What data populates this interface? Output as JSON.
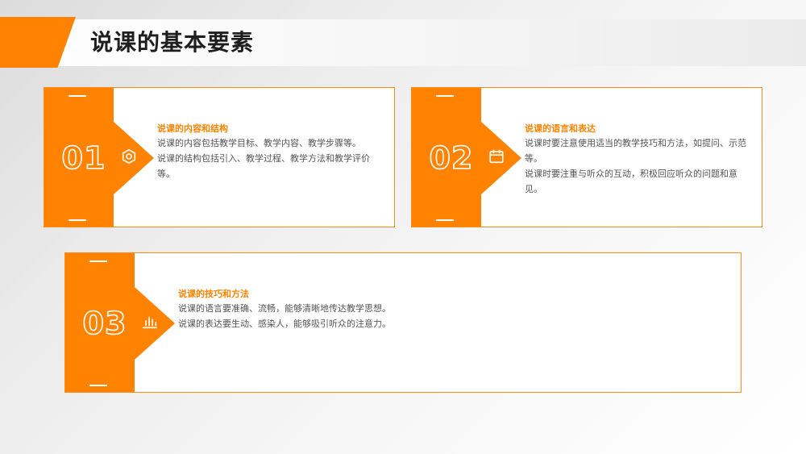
{
  "header": {
    "title": "说课的基本要素"
  },
  "cards": [
    {
      "number": "01",
      "icon": "hexagon-nut-icon",
      "heading": "说课的内容和结构",
      "lines": [
        "说课的内容包括教学目标、教学内容、教学步骤等。",
        "说课的结构包括引入、教学过程、教学方法和教学评价等。"
      ]
    },
    {
      "number": "02",
      "icon": "calendar-icon",
      "heading": "说课的语言和表达",
      "lines": [
        "说课时要注意使用适当的教学技巧和方法，如提问、示范等。",
        "说课时要注重与听众的互动，积极回应听众的问题和意见。"
      ]
    },
    {
      "number": "03",
      "icon": "bar-chart-icon",
      "heading": "说课的技巧和方法",
      "lines": [
        "说课的语言要准确、流畅，能够清晰地传达教学思想。",
        "说课的表达要生动、感染人，能够吸引听众的注意力。"
      ]
    }
  ],
  "colors": {
    "accent": "#ff8200",
    "title": "#1e1e1e",
    "body_text": "#555555"
  }
}
